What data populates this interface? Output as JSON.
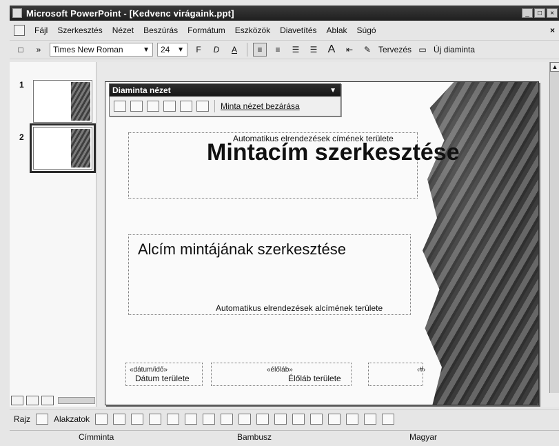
{
  "window": {
    "title": "Microsoft PowerPoint - [Kedvenc virágaink.ppt]",
    "controls": [
      "_",
      "□",
      "×"
    ]
  },
  "menubar": {
    "items": [
      "Fájl",
      "Szerkesztés",
      "Nézet",
      "Beszúrás",
      "Formátum",
      "Eszközök",
      "Diavetítés",
      "Ablak",
      "Súgó"
    ],
    "close": "×"
  },
  "toolbar": {
    "font": "Times New Roman",
    "size": "24",
    "bold": "F",
    "italic": "D",
    "underline": "A",
    "grow_text": "A",
    "design_label": "Tervezés",
    "new_slide_label": "Új diaminta",
    "overflow": "»"
  },
  "left_panel": {
    "thumbnails": [
      {
        "number": "1"
      },
      {
        "number": "2"
      }
    ]
  },
  "master_toolbar": {
    "title": "Diaminta nézet",
    "close_label": "Minta nézet bezárása"
  },
  "slide": {
    "title_placeholder_caption": "Automatikus elrendezések címének területe",
    "title_text": "Mintacím szerkesztése",
    "subtitle_text": "Alcím mintájának szerkesztése",
    "subtitle_placeholder_caption": "Automatikus elrendezések alcímének területe",
    "date_code": "«dátum/idő»",
    "date_label": "Dátum területe",
    "footer_code": "«élőláb»",
    "footer_label": "Élőláb területe",
    "number_code": "‹#›"
  },
  "drawbar": {
    "draw_label": "Rajz",
    "shapes_label": "Alakzatok"
  },
  "statusbar": {
    "left": "Címminta",
    "center": "Bambusz",
    "right": "Magyar"
  }
}
